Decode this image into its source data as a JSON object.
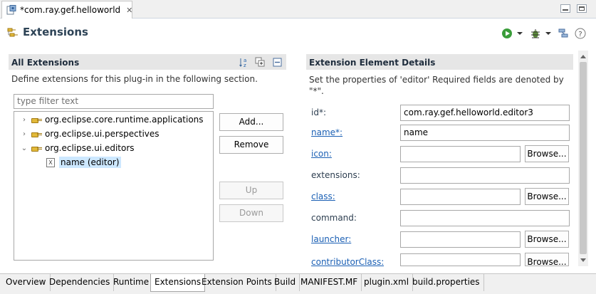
{
  "editor_tab": {
    "title": "*com.ray.gef.helloworld",
    "close": "✕"
  },
  "header": {
    "title": "Extensions"
  },
  "left": {
    "title": "All Extensions",
    "description": "Define extensions for this plug-in in the following section.",
    "filter_placeholder": "type filter text",
    "tree": [
      {
        "label": "org.eclipse.core.runtime.applications",
        "expander": "›",
        "icon": "extension-point-icon"
      },
      {
        "label": "org.eclipse.ui.perspectives",
        "expander": "›",
        "icon": "extension-point-icon"
      },
      {
        "label": "org.eclipse.ui.editors",
        "expander": "⌄",
        "icon": "extension-point-icon"
      },
      {
        "label": "name (editor)",
        "icon": "xml-element-icon"
      }
    ],
    "buttons": {
      "add": "Add...",
      "remove": "Remove",
      "up": "Up",
      "down": "Down"
    }
  },
  "right": {
    "title": "Extension Element Details",
    "description": "Set the properties of 'editor' Required fields are denoted by \"*\".",
    "fields": [
      {
        "label": "id*:",
        "value": "com.ray.gef.helloworld.editor3"
      },
      {
        "label": "name*:",
        "value": "name"
      },
      {
        "label": "icon:",
        "value": ""
      },
      {
        "label": "extensions:",
        "value": ""
      },
      {
        "label": "class:",
        "value": ""
      },
      {
        "label": "command:",
        "value": ""
      },
      {
        "label": "launcher:",
        "value": ""
      },
      {
        "label": "contributorClass:",
        "value": ""
      }
    ],
    "browse_label": "Browse..."
  },
  "page_tabs": [
    "Overview",
    "Dependencies",
    "Runtime",
    "Extensions",
    "Extension Points",
    "Build",
    "MANIFEST.MF",
    "plugin.xml",
    "build.properties"
  ],
  "active_page_tab": "Extensions",
  "colors": {
    "header_title": "#2d4356",
    "link": "#1a5fb4",
    "section_bar": "#e6e6e6",
    "selection": "#cde8ff"
  }
}
